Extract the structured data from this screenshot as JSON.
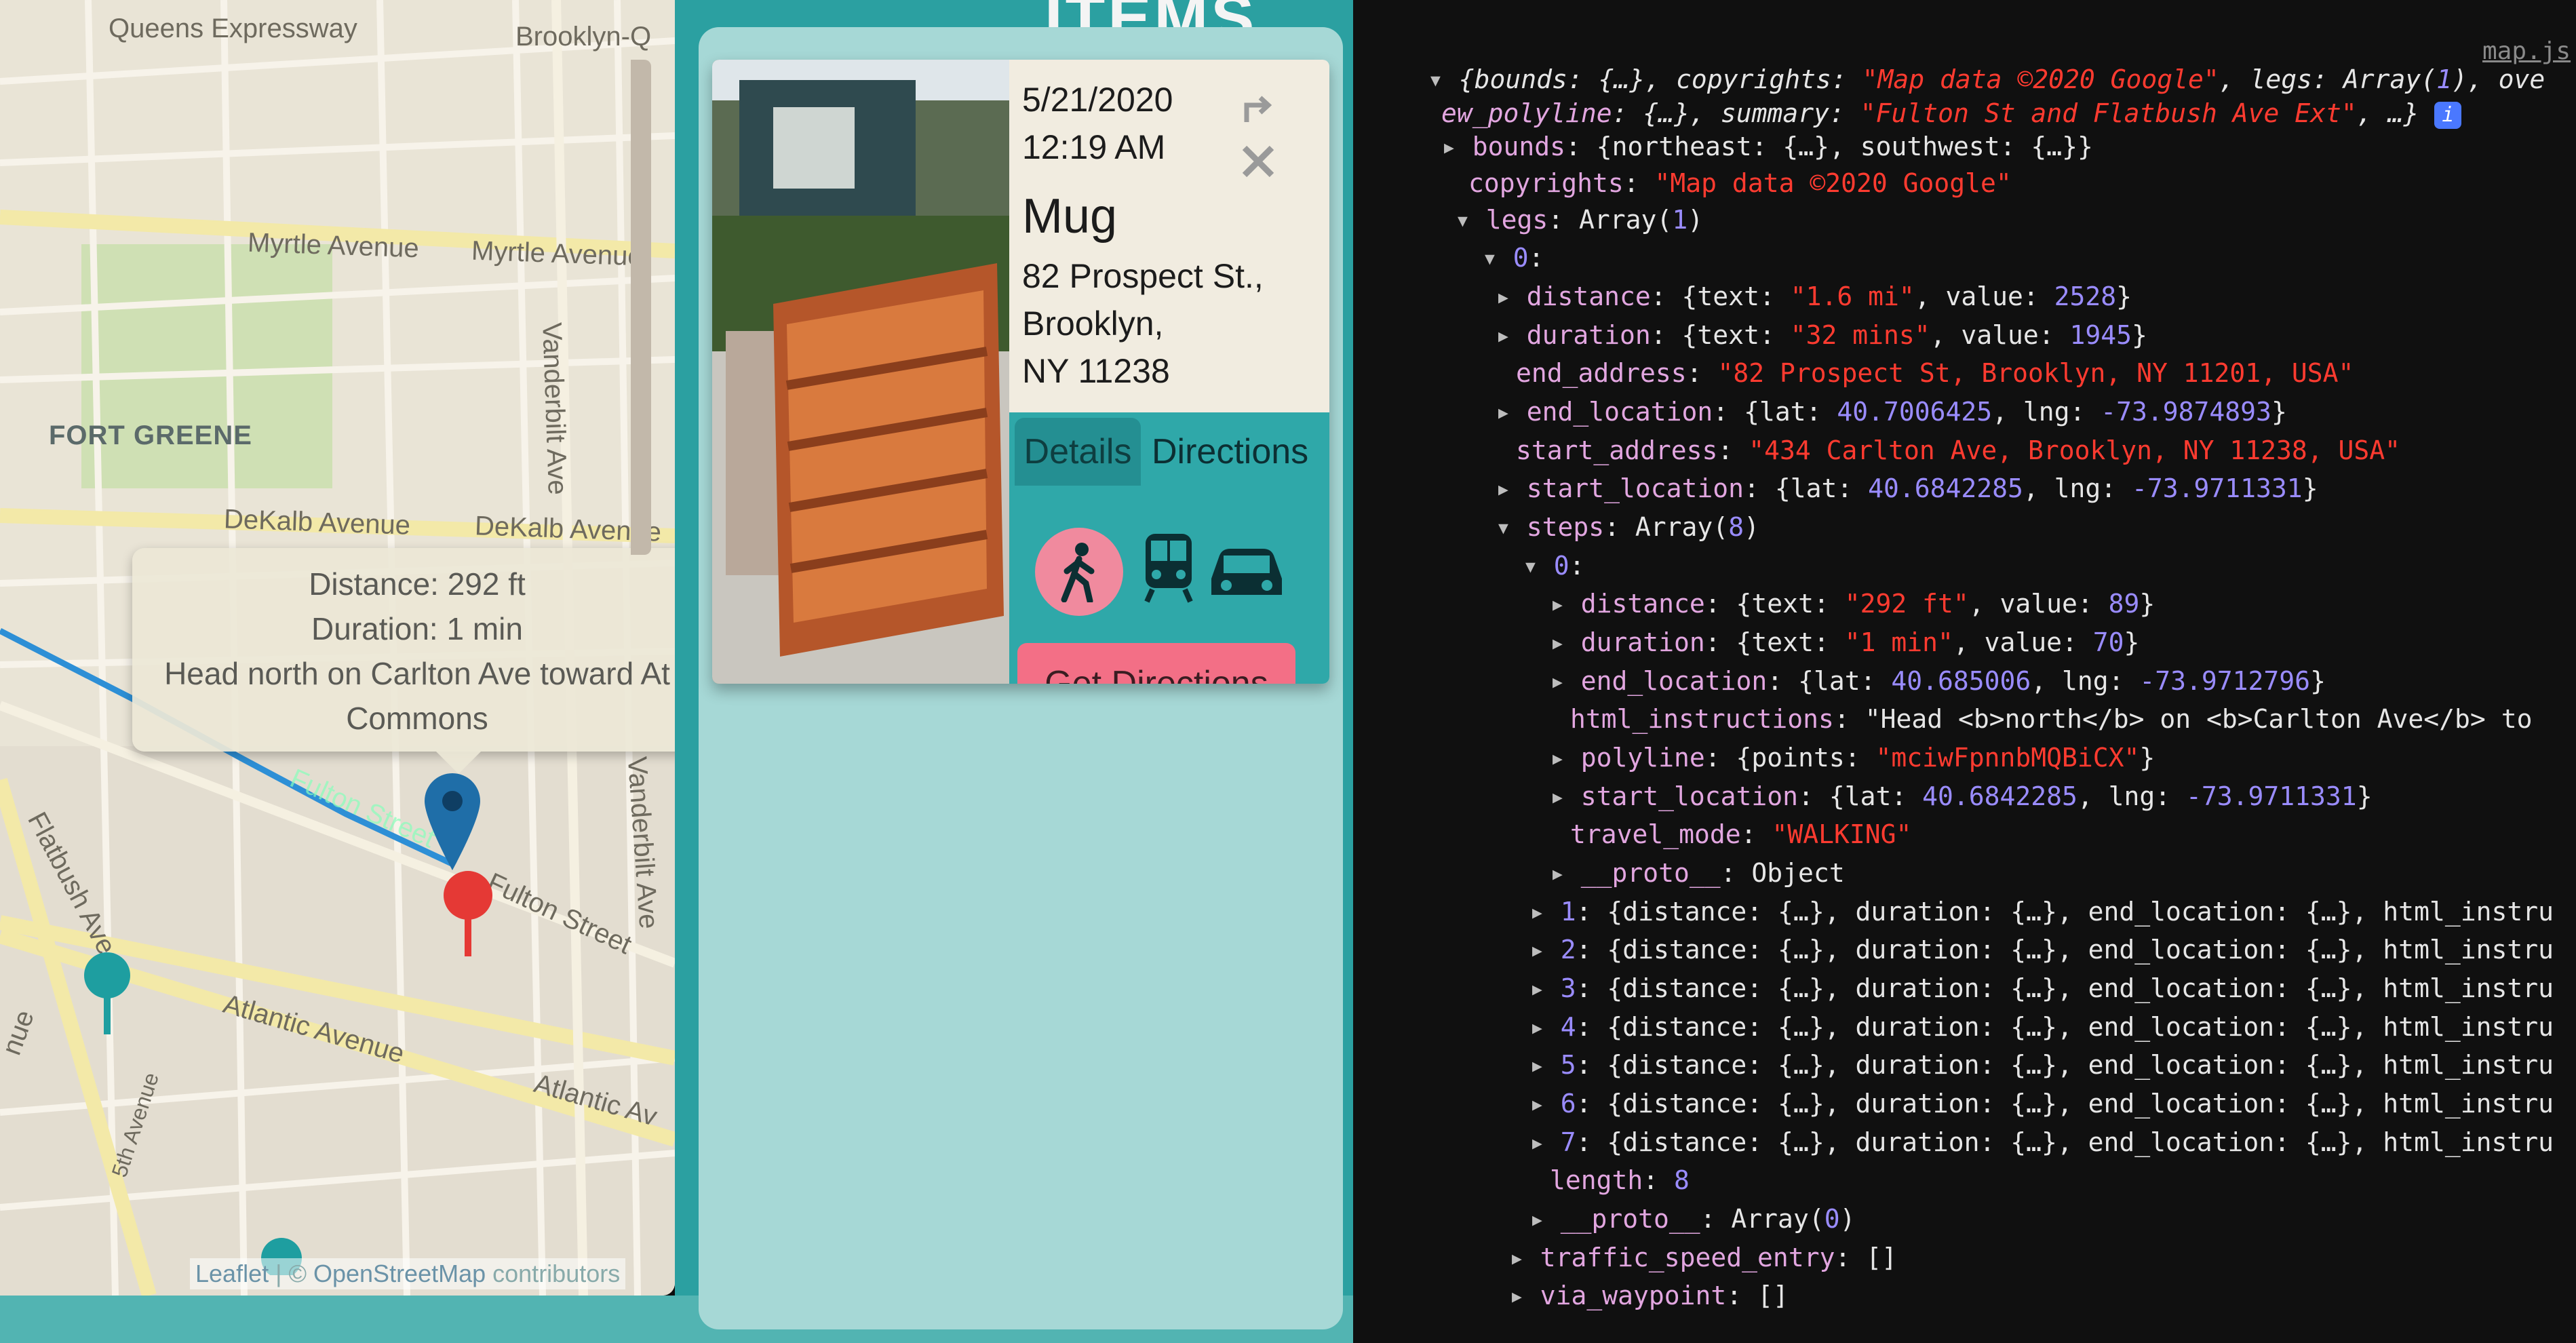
{
  "map": {
    "labels": {
      "expressway": "Queens Expressway",
      "brooklyn": "Brooklyn-Q",
      "myrtle1": "Myrtle Avenue",
      "myrtle2": "Myrtle Avenue",
      "fort_greene": "FORT GREENE",
      "vanderbilt": "Vanderbilt Ave",
      "vanderbilt2": "Vanderbilt Ave",
      "dekalb1": "DeKalb Avenue",
      "dekalb2": "DeKalb Avenue",
      "fulton_st": "Fulton Street",
      "fulton_st2": "Fulton Street",
      "flatbush": "Flatbush Ave",
      "atlantic1": "Atlantic Avenue",
      "atlantic2": "Atlantic Av",
      "fifth_ave": "5th Avenue",
      "nue": "nue"
    },
    "popup": {
      "distance": "Distance: 292 ft",
      "duration": "Duration: 1 min",
      "instruction": "Head north on Carlton Ave toward At",
      "instruction2": "Commons"
    },
    "attribution": {
      "leaflet": "Leaflet",
      "sep": " | © ",
      "osm": "OpenStreetMap",
      "contrib": " contributors"
    }
  },
  "items_title": "ITEMS",
  "item": {
    "date": "5/21/2020",
    "time": "12:19 AM",
    "name": "Mug",
    "address_line1": "82 Prospect St.,",
    "address_line2": "Brooklyn,",
    "address_line3": "NY 11238",
    "tabs": [
      "Details",
      "Directions"
    ],
    "modes": [
      "walking-icon",
      "transit-icon",
      "car-icon"
    ],
    "get_button": "Get Directions"
  },
  "devtools": {
    "file_link": "map.js",
    "lines": [
      "{bounds: {…}, copyrights: \"Map data ©2020 Google\", legs: Array(1), ove",
      "ew_polyline: {…}, summary: \"Fulton St and Flatbush Ave Ext\", …}",
      "bounds: {northeast: {…}, southwest: {…}}",
      "copyrights: \"Map data ©2020 Google\"",
      "legs: Array(1)",
      "0:",
      "distance: {text: \"1.6 mi\", value: 2528}",
      "duration: {text: \"32 mins\", value: 1945}",
      "end_address: \"82 Prospect St, Brooklyn, NY 11201, USA\"",
      "end_location: {lat: 40.7006425, lng: -73.9874893}",
      "start_address: \"434 Carlton Ave, Brooklyn, NY 11238, USA\"",
      "start_location: {lat: 40.6842285, lng: -73.9711331}",
      "steps: Array(8)",
      "0:",
      "distance: {text: \"292 ft\", value: 89}",
      "duration: {text: \"1 min\", value: 70}",
      "end_location: {lat: 40.685006, lng: -73.9712796}",
      "html_instructions: \"Head <b>north</b> on <b>Carlton Ave</b> to",
      "polyline: {points: \"mciwFpnnbMQBiCX\"}",
      "start_location: {lat: 40.6842285, lng: -73.9711331}",
      "travel_mode: \"WALKING\"",
      "__proto__: Object",
      "1: {distance: {…}, duration: {…}, end_location: {…}, html_instru",
      "2: {distance: {…}, duration: {…}, end_location: {…}, html_instru",
      "3: {distance: {…}, duration: {…}, end_location: {…}, html_instru",
      "4: {distance: {…}, duration: {…}, end_location: {…}, html_instru",
      "5: {distance: {…}, duration: {…}, end_location: {…}, html_instru",
      "6: {distance: {…}, duration: {…}, end_location: {…}, html_instru",
      "7: {distance: {…}, duration: {…}, end_location: {…}, html_instru",
      "length: 8",
      "__proto__: Array(0)",
      "traffic_speed_entry: []",
      "via_waypoint: []"
    ]
  },
  "colors": {
    "teal": "#2ba0a1",
    "panel": "#a6d8d6",
    "route": "#2d8fd6",
    "marker_teal": "#1e9ea0",
    "marker_red": "#e53935",
    "button_pink": "#f36f86"
  }
}
